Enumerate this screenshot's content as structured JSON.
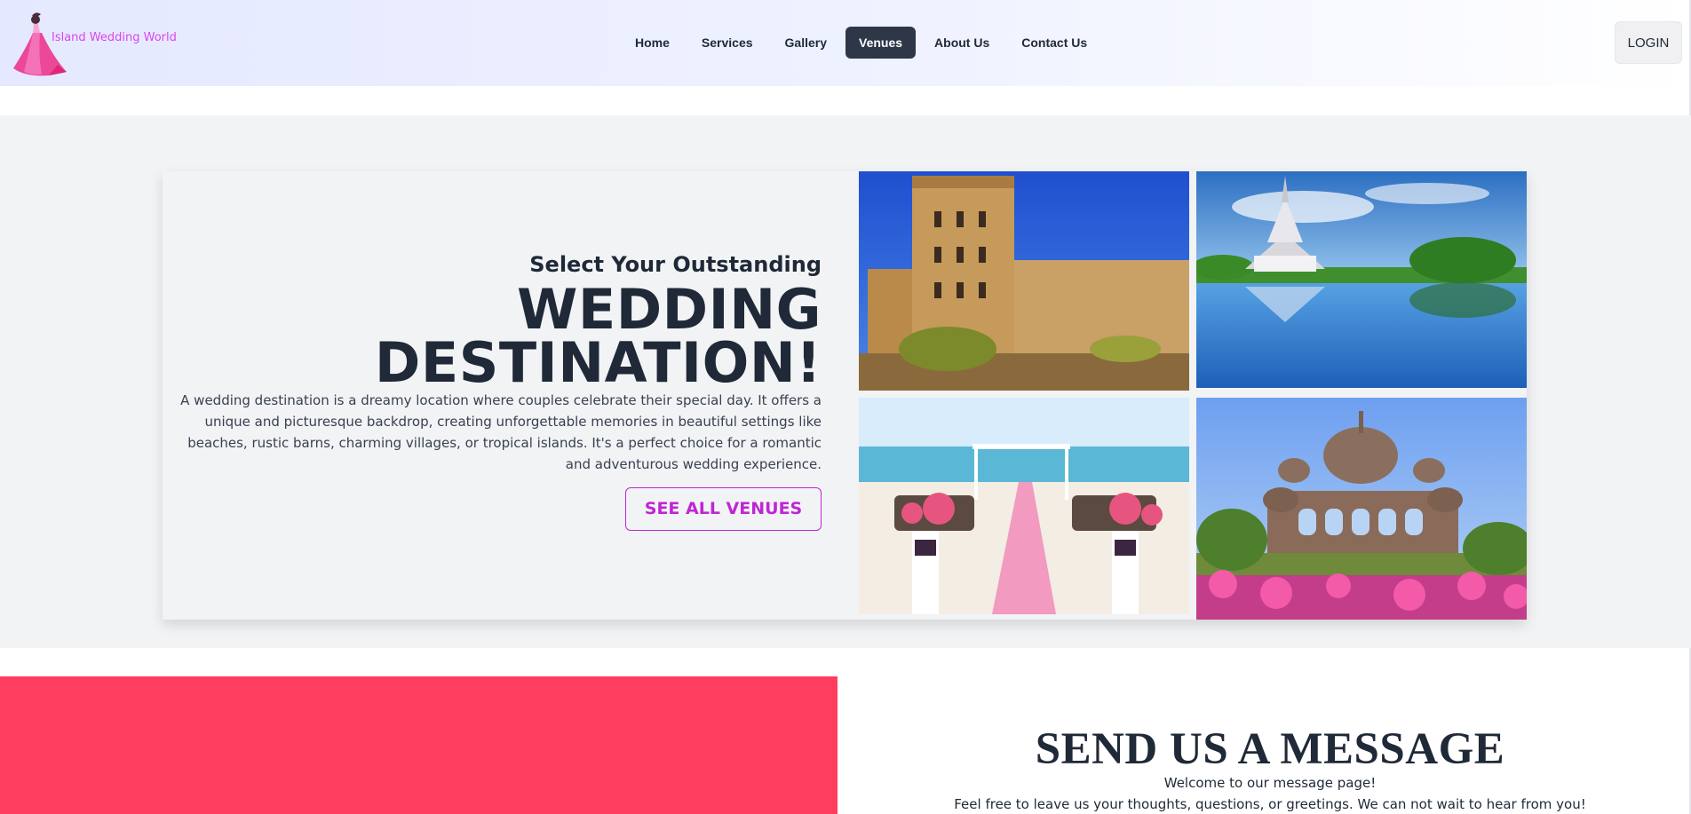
{
  "brand": {
    "name": "Island Wedding World",
    "color": "#d946ef"
  },
  "nav": {
    "links": [
      "Home",
      "Services",
      "Gallery",
      "Venues",
      "About Us",
      "Contact Us"
    ],
    "active": "Venues",
    "login_label": "LOGIN"
  },
  "hero": {
    "subtitle": "Select Your Outstanding",
    "title_line1": "WEDDING",
    "title_line2": "DESTINATION!",
    "description": "A wedding destination is a dreamy location where couples celebrate their special day. It offers a unique and picturesque backdrop, creating unforgettable memories in beautiful settings like beaches, rustic barns, charming villages, or tropical islands. It's a perfect choice for a romantic and adventurous wedding experience.",
    "cta_label": "SEE ALL VENUES",
    "images": [
      "castle-venue-photo",
      "thai-temple-lake-photo",
      "beach-wedding-aisle-photo",
      "indian-palace-garden-photo"
    ]
  },
  "message": {
    "title": "SEND US A MESSAGE",
    "line1": "Welcome to our message page!",
    "line2": "Feel free to leave us your thoughts, questions, or greetings. We can not wait to hear from you!"
  },
  "colors": {
    "accent": "#c026d3",
    "nav_active_bg": "#2d3748",
    "banner": "#ff3d5f",
    "text_dark": "#1f2937"
  }
}
